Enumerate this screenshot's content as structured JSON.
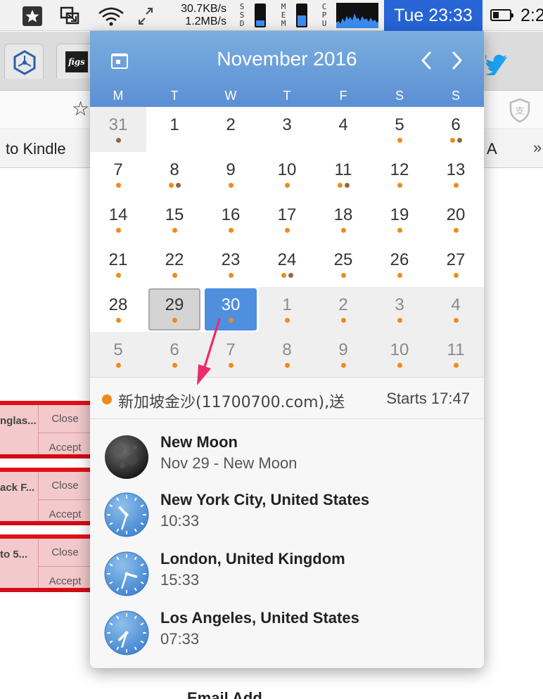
{
  "menubar": {
    "net_up": "30.7KB/s",
    "net_down": "1.2MB/s",
    "ssd_letters": [
      "S",
      "S",
      "D"
    ],
    "mem_letters": [
      "M",
      "E",
      "M"
    ],
    "cpu_letters": [
      "C",
      "P",
      "U"
    ],
    "ssd_level": 0.35,
    "mem_level": 0.55,
    "clock": "Tue 23:33",
    "clock_clipped": "2:2",
    "battery_level": 0.35,
    "icons": [
      "star-icon",
      "screen-share-icon",
      "wifi-icon",
      "fullscreen-icon",
      "battery-icon"
    ]
  },
  "browser": {
    "bookmark_kindle": "to Kindle",
    "bookmark_a": "A",
    "bookmark_more": "»",
    "tab_icons": [
      "hexagon-icon",
      "figs-icon",
      "twitter-icon"
    ],
    "tab_figs_label": "figs"
  },
  "notifications": [
    {
      "title": "nglas...",
      "close": "Close",
      "accept": "Accept"
    },
    {
      "title": "ack F...",
      "close": "Close",
      "accept": "Accept"
    },
    {
      "title": "to 5...",
      "close": "Close",
      "accept": "Accept"
    }
  ],
  "background_text": "Email Add",
  "calendar": {
    "title": "November 2016",
    "weekdays": [
      "M",
      "T",
      "W",
      "T",
      "F",
      "S",
      "S"
    ],
    "colors": {
      "orange": "#f08a1a",
      "brown": "#8c6a48",
      "header": "#6b9fdb",
      "today": "#4f8fe0"
    },
    "days": [
      {
        "n": "31",
        "kind": "prev",
        "dots": [
          "brown"
        ]
      },
      {
        "n": "1",
        "dots": []
      },
      {
        "n": "2",
        "dots": []
      },
      {
        "n": "3",
        "dots": []
      },
      {
        "n": "4",
        "dots": []
      },
      {
        "n": "5",
        "dots": [
          "orange"
        ]
      },
      {
        "n": "6",
        "dots": [
          "orange",
          "brown"
        ]
      },
      {
        "n": "7",
        "dots": [
          "orange"
        ]
      },
      {
        "n": "8",
        "dots": [
          "orange",
          "brown"
        ]
      },
      {
        "n": "9",
        "dots": [
          "orange"
        ]
      },
      {
        "n": "10",
        "dots": [
          "orange"
        ]
      },
      {
        "n": "11",
        "dots": [
          "orange",
          "brown"
        ]
      },
      {
        "n": "12",
        "dots": [
          "orange"
        ]
      },
      {
        "n": "13",
        "dots": [
          "orange"
        ]
      },
      {
        "n": "14",
        "dots": [
          "orange"
        ]
      },
      {
        "n": "15",
        "dots": [
          "orange"
        ]
      },
      {
        "n": "16",
        "dots": [
          "orange"
        ]
      },
      {
        "n": "17",
        "dots": [
          "orange"
        ]
      },
      {
        "n": "18",
        "dots": [
          "orange"
        ]
      },
      {
        "n": "19",
        "dots": [
          "orange"
        ]
      },
      {
        "n": "20",
        "dots": [
          "orange"
        ]
      },
      {
        "n": "21",
        "dots": [
          "orange"
        ]
      },
      {
        "n": "22",
        "dots": [
          "orange"
        ]
      },
      {
        "n": "23",
        "dots": [
          "orange"
        ]
      },
      {
        "n": "24",
        "dots": [
          "orange",
          "brown"
        ]
      },
      {
        "n": "25",
        "dots": [
          "orange"
        ]
      },
      {
        "n": "26",
        "dots": [
          "orange"
        ]
      },
      {
        "n": "27",
        "dots": [
          "orange"
        ]
      },
      {
        "n": "28",
        "dots": [
          "orange"
        ]
      },
      {
        "n": "29",
        "kind": "selected",
        "dots": [
          "orange"
        ]
      },
      {
        "n": "30",
        "kind": "today",
        "dots": [
          "orange"
        ]
      },
      {
        "n": "1",
        "kind": "next",
        "dots": [
          "orange"
        ]
      },
      {
        "n": "2",
        "kind": "next",
        "dots": [
          "orange"
        ]
      },
      {
        "n": "3",
        "kind": "next",
        "dots": [
          "orange"
        ]
      },
      {
        "n": "4",
        "kind": "next",
        "dots": [
          "orange"
        ]
      },
      {
        "n": "5",
        "kind": "next",
        "dots": [
          "orange"
        ]
      },
      {
        "n": "6",
        "kind": "next",
        "dots": [
          "orange"
        ]
      },
      {
        "n": "7",
        "kind": "next",
        "dots": [
          "orange"
        ]
      },
      {
        "n": "8",
        "kind": "next",
        "dots": [
          "orange"
        ]
      },
      {
        "n": "9",
        "kind": "next",
        "dots": [
          "orange"
        ]
      },
      {
        "n": "10",
        "kind": "next",
        "dots": [
          "orange"
        ]
      },
      {
        "n": "11",
        "kind": "next",
        "dots": [
          "orange"
        ]
      }
    ],
    "event": {
      "title": "新加坡金沙(11700700.com),送",
      "starts": "Starts 17:47"
    },
    "info": [
      {
        "icon": "moon-icon",
        "title": "New Moon",
        "subtitle": "Nov 29 - New Moon"
      },
      {
        "icon": "clock-icon",
        "title": "New York City, United States",
        "subtitle": "10:33",
        "hour": 10,
        "minute": 33
      },
      {
        "icon": "clock-icon",
        "title": "London, United Kingdom",
        "subtitle": "15:33",
        "hour": 15,
        "minute": 33
      },
      {
        "icon": "clock-icon",
        "title": "Los Angeles, United States",
        "subtitle": "07:33",
        "hour": 7,
        "minute": 33
      }
    ]
  }
}
